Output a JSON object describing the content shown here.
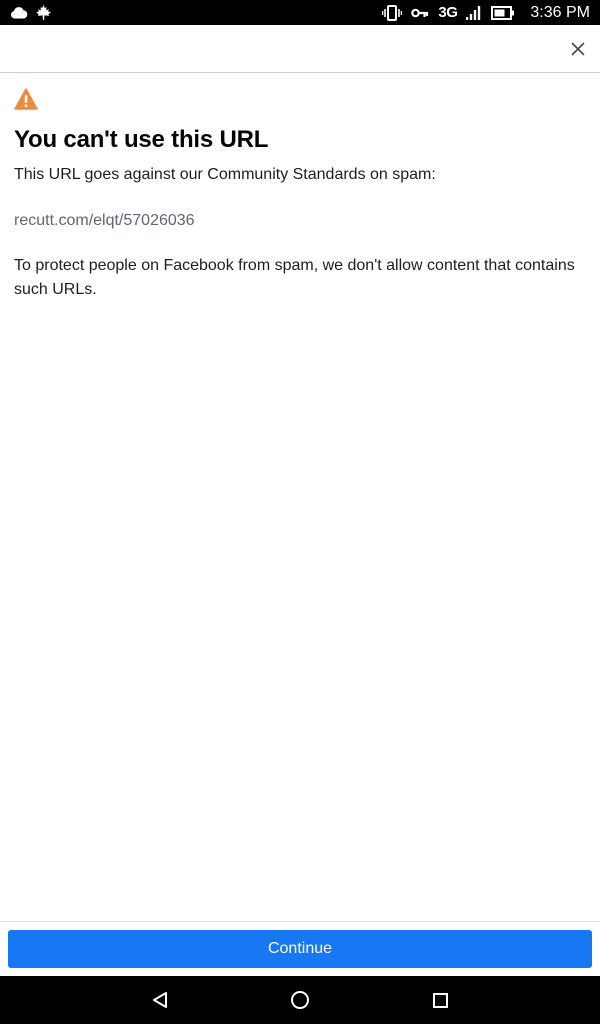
{
  "status_bar": {
    "network": "3G",
    "time": "3:36 PM",
    "icons": [
      "cloud-icon",
      "maple-leaf-icon",
      "vibrate-icon",
      "key-icon",
      "signal-icon",
      "battery-icon"
    ]
  },
  "top_bar": {
    "close_icon": "close-icon"
  },
  "notice": {
    "warning_color": "#f0883e",
    "title": "You can't use this URL",
    "intro": "This URL goes against our Community Standards on spam:",
    "url": "recutt.com/elqt/57026036",
    "explanation": "To protect people on Facebook from spam, we don't allow content that contains such URLs."
  },
  "footer": {
    "continue_label": "Continue",
    "button_color": "#1877f2"
  },
  "nav_bar": {
    "icons": [
      "back-icon",
      "home-icon",
      "recents-icon"
    ]
  }
}
